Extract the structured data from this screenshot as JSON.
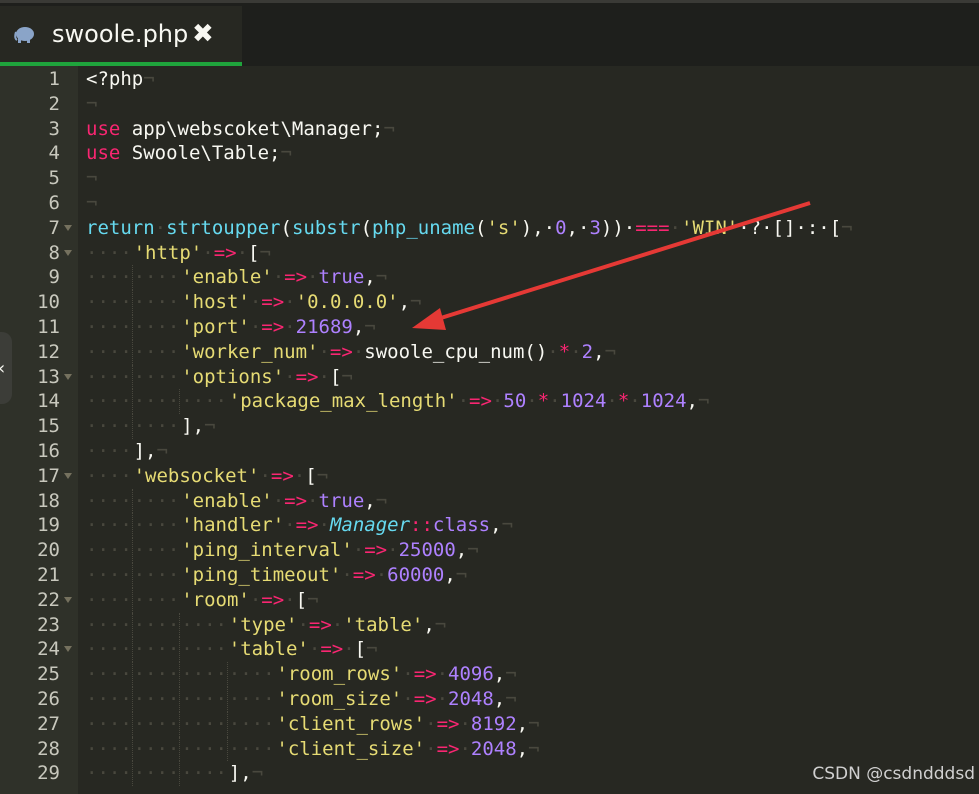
{
  "tab": {
    "title": "swoole.php",
    "close_glyph": "✖",
    "icon": "php-elephant-icon",
    "accent": "#1fa43c"
  },
  "watermark": "CSDN @csdndddsd",
  "colors": {
    "background": "#272822",
    "keyword": "#f92672",
    "function": "#66d9ef",
    "string": "#e6db74",
    "number": "#ae81ff",
    "annotation_arrow": "#e53935"
  },
  "lines": [
    {
      "n": "1",
      "fold": false,
      "indent": 0,
      "tokens": [
        {
          "t": "<?php",
          "c": "plain"
        },
        {
          "t": "¬",
          "c": "ws"
        }
      ]
    },
    {
      "n": "2",
      "fold": false,
      "indent": 0,
      "tokens": [
        {
          "t": "¬",
          "c": "ws"
        }
      ]
    },
    {
      "n": "3",
      "fold": false,
      "indent": 0,
      "tokens": [
        {
          "t": "use",
          "c": "kw"
        },
        {
          "t": " app\\webscoket\\Manager;",
          "c": "plain"
        },
        {
          "t": "¬",
          "c": "ws"
        }
      ]
    },
    {
      "n": "4",
      "fold": false,
      "indent": 0,
      "tokens": [
        {
          "t": "use",
          "c": "kw"
        },
        {
          "t": " Swoole\\Table;",
          "c": "plain"
        },
        {
          "t": "¬",
          "c": "ws"
        }
      ]
    },
    {
      "n": "5",
      "fold": false,
      "indent": 0,
      "tokens": [
        {
          "t": "¬",
          "c": "ws"
        }
      ]
    },
    {
      "n": "6",
      "fold": false,
      "indent": 0,
      "tokens": [
        {
          "t": "¬",
          "c": "ws"
        }
      ]
    },
    {
      "n": "7",
      "fold": true,
      "indent": 0,
      "tokens": [
        {
          "t": "return",
          "c": "fn"
        },
        {
          "t": "·",
          "c": "ws"
        },
        {
          "t": "strtoupper",
          "c": "fn"
        },
        {
          "t": "(",
          "c": "plain"
        },
        {
          "t": "substr",
          "c": "fn"
        },
        {
          "t": "(",
          "c": "plain"
        },
        {
          "t": "php_uname",
          "c": "fn"
        },
        {
          "t": "(",
          "c": "plain"
        },
        {
          "t": "'s'",
          "c": "str"
        },
        {
          "t": "),·",
          "c": "plain"
        },
        {
          "t": "0",
          "c": "num"
        },
        {
          "t": ",·",
          "c": "plain"
        },
        {
          "t": "3",
          "c": "num"
        },
        {
          "t": "))·",
          "c": "plain"
        },
        {
          "t": "===",
          "c": "op"
        },
        {
          "t": "·",
          "c": "ws"
        },
        {
          "t": "'WIN'",
          "c": "str"
        },
        {
          "t": "·?·[]·:·[",
          "c": "plain"
        },
        {
          "t": "¬",
          "c": "ws"
        }
      ]
    },
    {
      "n": "8",
      "fold": true,
      "indent": 1,
      "tokens": [
        {
          "t": "'http'",
          "c": "str"
        },
        {
          "t": "·",
          "c": "ws"
        },
        {
          "t": "=>",
          "c": "op"
        },
        {
          "t": "·",
          "c": "ws"
        },
        {
          "t": "[",
          "c": "plain"
        },
        {
          "t": "¬",
          "c": "ws"
        }
      ]
    },
    {
      "n": "9",
      "fold": false,
      "indent": 2,
      "tokens": [
        {
          "t": "'enable'",
          "c": "str"
        },
        {
          "t": "·",
          "c": "ws"
        },
        {
          "t": "=>",
          "c": "op"
        },
        {
          "t": "·",
          "c": "ws"
        },
        {
          "t": "true",
          "c": "num"
        },
        {
          "t": ",",
          "c": "plain"
        },
        {
          "t": "¬",
          "c": "ws"
        }
      ]
    },
    {
      "n": "10",
      "fold": false,
      "indent": 2,
      "tokens": [
        {
          "t": "'host'",
          "c": "str"
        },
        {
          "t": "·",
          "c": "ws"
        },
        {
          "t": "=>",
          "c": "op"
        },
        {
          "t": "·",
          "c": "ws"
        },
        {
          "t": "'0.0.0.0'",
          "c": "str"
        },
        {
          "t": ",",
          "c": "plain"
        },
        {
          "t": "¬",
          "c": "ws"
        }
      ]
    },
    {
      "n": "11",
      "fold": false,
      "indent": 2,
      "tokens": [
        {
          "t": "'port'",
          "c": "str"
        },
        {
          "t": "·",
          "c": "ws"
        },
        {
          "t": "=>",
          "c": "op"
        },
        {
          "t": "·",
          "c": "ws"
        },
        {
          "t": "21689",
          "c": "num"
        },
        {
          "t": ",",
          "c": "plain"
        },
        {
          "t": "¬",
          "c": "ws"
        }
      ]
    },
    {
      "n": "12",
      "fold": false,
      "indent": 2,
      "tokens": [
        {
          "t": "'worker_num'",
          "c": "str"
        },
        {
          "t": "·",
          "c": "ws"
        },
        {
          "t": "=>",
          "c": "op"
        },
        {
          "t": "·",
          "c": "ws"
        },
        {
          "t": "swoole_cpu_num()",
          "c": "plain"
        },
        {
          "t": "·",
          "c": "ws"
        },
        {
          "t": "*",
          "c": "op"
        },
        {
          "t": "·",
          "c": "ws"
        },
        {
          "t": "2",
          "c": "num"
        },
        {
          "t": ",",
          "c": "plain"
        },
        {
          "t": "¬",
          "c": "ws"
        }
      ]
    },
    {
      "n": "13",
      "fold": true,
      "indent": 2,
      "tokens": [
        {
          "t": "'options'",
          "c": "str"
        },
        {
          "t": "·",
          "c": "ws"
        },
        {
          "t": "=>",
          "c": "op"
        },
        {
          "t": "·",
          "c": "ws"
        },
        {
          "t": "[",
          "c": "plain"
        },
        {
          "t": "¬",
          "c": "ws"
        }
      ]
    },
    {
      "n": "14",
      "fold": false,
      "indent": 3,
      "tokens": [
        {
          "t": "'package_max_length'",
          "c": "str"
        },
        {
          "t": "·",
          "c": "ws"
        },
        {
          "t": "=>",
          "c": "op"
        },
        {
          "t": "·",
          "c": "ws"
        },
        {
          "t": "50",
          "c": "num"
        },
        {
          "t": "·",
          "c": "ws"
        },
        {
          "t": "*",
          "c": "op"
        },
        {
          "t": "·",
          "c": "ws"
        },
        {
          "t": "1024",
          "c": "num"
        },
        {
          "t": "·",
          "c": "ws"
        },
        {
          "t": "*",
          "c": "op"
        },
        {
          "t": "·",
          "c": "ws"
        },
        {
          "t": "1024",
          "c": "num"
        },
        {
          "t": ",",
          "c": "plain"
        },
        {
          "t": "¬",
          "c": "ws"
        }
      ]
    },
    {
      "n": "15",
      "fold": false,
      "indent": 2,
      "tokens": [
        {
          "t": "],",
          "c": "plain"
        },
        {
          "t": "¬",
          "c": "ws"
        }
      ]
    },
    {
      "n": "16",
      "fold": false,
      "indent": 1,
      "tokens": [
        {
          "t": "],",
          "c": "plain"
        },
        {
          "t": "¬",
          "c": "ws"
        }
      ]
    },
    {
      "n": "17",
      "fold": true,
      "indent": 1,
      "tokens": [
        {
          "t": "'websocket'",
          "c": "str"
        },
        {
          "t": "·",
          "c": "ws"
        },
        {
          "t": "=>",
          "c": "op"
        },
        {
          "t": "·",
          "c": "ws"
        },
        {
          "t": "[",
          "c": "plain"
        },
        {
          "t": "¬",
          "c": "ws"
        }
      ]
    },
    {
      "n": "18",
      "fold": false,
      "indent": 2,
      "tokens": [
        {
          "t": "'enable'",
          "c": "str"
        },
        {
          "t": "·",
          "c": "ws"
        },
        {
          "t": "=>",
          "c": "op"
        },
        {
          "t": "·",
          "c": "ws"
        },
        {
          "t": "true",
          "c": "num"
        },
        {
          "t": ",",
          "c": "plain"
        },
        {
          "t": "¬",
          "c": "ws"
        }
      ]
    },
    {
      "n": "19",
      "fold": false,
      "indent": 2,
      "tokens": [
        {
          "t": "'handler'",
          "c": "str"
        },
        {
          "t": "·",
          "c": "ws"
        },
        {
          "t": "=>",
          "c": "op"
        },
        {
          "t": "·",
          "c": "ws"
        },
        {
          "t": "Manager",
          "c": "type"
        },
        {
          "t": "::",
          "c": "op"
        },
        {
          "t": "class",
          "c": "const"
        },
        {
          "t": ",",
          "c": "plain"
        },
        {
          "t": "¬",
          "c": "ws"
        }
      ]
    },
    {
      "n": "20",
      "fold": false,
      "indent": 2,
      "tokens": [
        {
          "t": "'ping_interval'",
          "c": "str"
        },
        {
          "t": "·",
          "c": "ws"
        },
        {
          "t": "=>",
          "c": "op"
        },
        {
          "t": "·",
          "c": "ws"
        },
        {
          "t": "25000",
          "c": "num"
        },
        {
          "t": ",",
          "c": "plain"
        },
        {
          "t": "¬",
          "c": "ws"
        }
      ]
    },
    {
      "n": "21",
      "fold": false,
      "indent": 2,
      "tokens": [
        {
          "t": "'ping_timeout'",
          "c": "str"
        },
        {
          "t": "·",
          "c": "ws"
        },
        {
          "t": "=>",
          "c": "op"
        },
        {
          "t": "·",
          "c": "ws"
        },
        {
          "t": "60000",
          "c": "num"
        },
        {
          "t": ",",
          "c": "plain"
        },
        {
          "t": "¬",
          "c": "ws"
        }
      ]
    },
    {
      "n": "22",
      "fold": true,
      "indent": 2,
      "tokens": [
        {
          "t": "'room'",
          "c": "str"
        },
        {
          "t": "·",
          "c": "ws"
        },
        {
          "t": "=>",
          "c": "op"
        },
        {
          "t": "·",
          "c": "ws"
        },
        {
          "t": "[",
          "c": "plain"
        },
        {
          "t": "¬",
          "c": "ws"
        }
      ]
    },
    {
      "n": "23",
      "fold": false,
      "indent": 3,
      "tokens": [
        {
          "t": "'type'",
          "c": "str"
        },
        {
          "t": "·",
          "c": "ws"
        },
        {
          "t": "=>",
          "c": "op"
        },
        {
          "t": "·",
          "c": "ws"
        },
        {
          "t": "'table'",
          "c": "str"
        },
        {
          "t": ",",
          "c": "plain"
        },
        {
          "t": "¬",
          "c": "ws"
        }
      ]
    },
    {
      "n": "24",
      "fold": true,
      "indent": 3,
      "tokens": [
        {
          "t": "'table'",
          "c": "str"
        },
        {
          "t": "·",
          "c": "ws"
        },
        {
          "t": "=>",
          "c": "op"
        },
        {
          "t": "·",
          "c": "ws"
        },
        {
          "t": "[",
          "c": "plain"
        },
        {
          "t": "¬",
          "c": "ws"
        }
      ]
    },
    {
      "n": "25",
      "fold": false,
      "indent": 4,
      "tokens": [
        {
          "t": "'room_rows'",
          "c": "str"
        },
        {
          "t": "·",
          "c": "ws"
        },
        {
          "t": "=>",
          "c": "op"
        },
        {
          "t": "·",
          "c": "ws"
        },
        {
          "t": "4096",
          "c": "num"
        },
        {
          "t": ",",
          "c": "plain"
        },
        {
          "t": "¬",
          "c": "ws"
        }
      ]
    },
    {
      "n": "26",
      "fold": false,
      "indent": 4,
      "tokens": [
        {
          "t": "'room_size'",
          "c": "str"
        },
        {
          "t": "·",
          "c": "ws"
        },
        {
          "t": "=>",
          "c": "op"
        },
        {
          "t": "·",
          "c": "ws"
        },
        {
          "t": "2048",
          "c": "num"
        },
        {
          "t": ",",
          "c": "plain"
        },
        {
          "t": "¬",
          "c": "ws"
        }
      ]
    },
    {
      "n": "27",
      "fold": false,
      "indent": 4,
      "tokens": [
        {
          "t": "'client_rows'",
          "c": "str"
        },
        {
          "t": "·",
          "c": "ws"
        },
        {
          "t": "=>",
          "c": "op"
        },
        {
          "t": "·",
          "c": "ws"
        },
        {
          "t": "8192",
          "c": "num"
        },
        {
          "t": ",",
          "c": "plain"
        },
        {
          "t": "¬",
          "c": "ws"
        }
      ]
    },
    {
      "n": "28",
      "fold": false,
      "indent": 4,
      "tokens": [
        {
          "t": "'client_size'",
          "c": "str"
        },
        {
          "t": "·",
          "c": "ws"
        },
        {
          "t": "=>",
          "c": "op"
        },
        {
          "t": "·",
          "c": "ws"
        },
        {
          "t": "2048",
          "c": "num"
        },
        {
          "t": ",",
          "c": "plain"
        },
        {
          "t": "¬",
          "c": "ws"
        }
      ]
    },
    {
      "n": "29",
      "fold": false,
      "indent": 3,
      "tokens": [
        {
          "t": "],",
          "c": "plain"
        },
        {
          "t": "¬",
          "c": "ws"
        }
      ]
    }
  ]
}
